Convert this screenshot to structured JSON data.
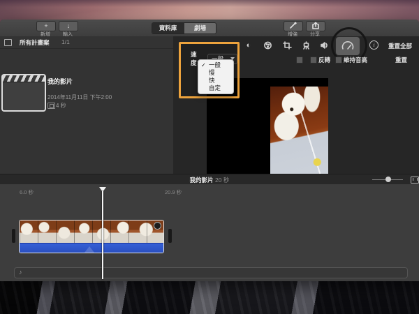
{
  "toolbar": {
    "new_button": {
      "label": "新增",
      "glyph": "+"
    },
    "import_button": {
      "label": "輸入",
      "glyph": "↓"
    },
    "view_tabs": {
      "library": "資料庫",
      "theater": "劇場"
    },
    "enhance_button": {
      "label": "增強"
    },
    "share_button": {
      "label": "分享"
    }
  },
  "sidebar": {
    "header": {
      "title": "所有計畫案",
      "count": "1/1"
    },
    "project": {
      "title": "我的影片",
      "date": "2014年11月11日 下午2:00",
      "duration": "4 秒"
    }
  },
  "viewer": {
    "reset_all_label": "重置全部",
    "reset_label": "重置",
    "reverse_label": "反轉",
    "preserve_pitch_label": "維持音高",
    "speed_control": {
      "label": "速度：",
      "value": "一般",
      "check_glyph": "✓",
      "menu_items": [
        {
          "label": "一般",
          "checked": true
        },
        {
          "label": "慢",
          "checked": false
        },
        {
          "label": "快",
          "checked": false
        },
        {
          "label": "自定",
          "checked": false
        }
      ]
    },
    "info_glyph": "i"
  },
  "timeline": {
    "clip_title": "我的影片",
    "clip_duration": "20 秒",
    "ruler": {
      "tick_left": "6.0 秒",
      "tick_right": "20.9 秒"
    },
    "music_note_glyph": "♪"
  },
  "colors": {
    "highlight_orange": "#eda33d",
    "audio_blue": "#2e55c8",
    "annotation_circle": "#161616"
  }
}
